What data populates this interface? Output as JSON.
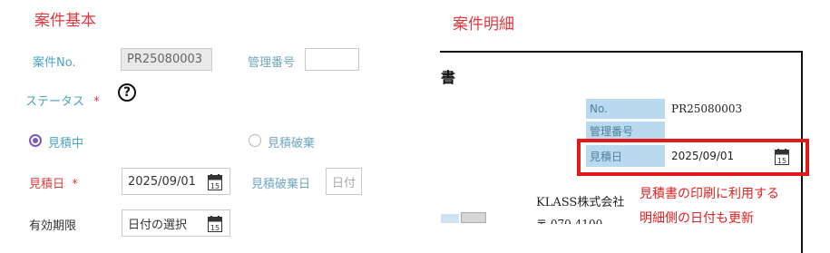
{
  "left": {
    "section_title": "案件基本",
    "case_no": {
      "label": "案件No.",
      "value": "PR25080003"
    },
    "management_no": {
      "label": "管理番号",
      "value": ""
    },
    "status": {
      "label": "ステータス",
      "required_mark": "*",
      "help_symbol": "?"
    },
    "radio_estimating": {
      "label": "見積中",
      "selected": true
    },
    "radio_discarded": {
      "label": "見積破棄",
      "selected": false
    },
    "estimate_date": {
      "label": "見積日",
      "required_mark": "*",
      "value": "2025/09/01"
    },
    "discard_date": {
      "label": "見積破棄日",
      "value": "日付"
    },
    "valid_until": {
      "label": "有効期限",
      "value": "日付の選択"
    },
    "calendar_day": "15"
  },
  "right": {
    "section_title": "案件明細",
    "doc_fragment_char": "書",
    "rows": [
      {
        "label": "No.",
        "value": "PR25080003"
      },
      {
        "label": "管理番号",
        "value": ""
      },
      {
        "label": "見積日",
        "value": "2025/09/01"
      }
    ],
    "company": "KLASS株式会社",
    "address_fragment": "〒 070-4100",
    "note_line1": "見積書の印刷に利用する",
    "note_line2": "明細側の日付も更新",
    "calendar_day": "15"
  },
  "colors": {
    "accent_red": "#e0393e",
    "label_teal": "#4aa3c4",
    "radio_purple": "#7b5ab8",
    "highlight_box": "#e01a1a",
    "doc_cell_blue": "#b9d9ef"
  },
  "icons": [
    "calendar-icon",
    "help-circle-icon",
    "radio-selected-icon",
    "radio-unselected-icon"
  ]
}
